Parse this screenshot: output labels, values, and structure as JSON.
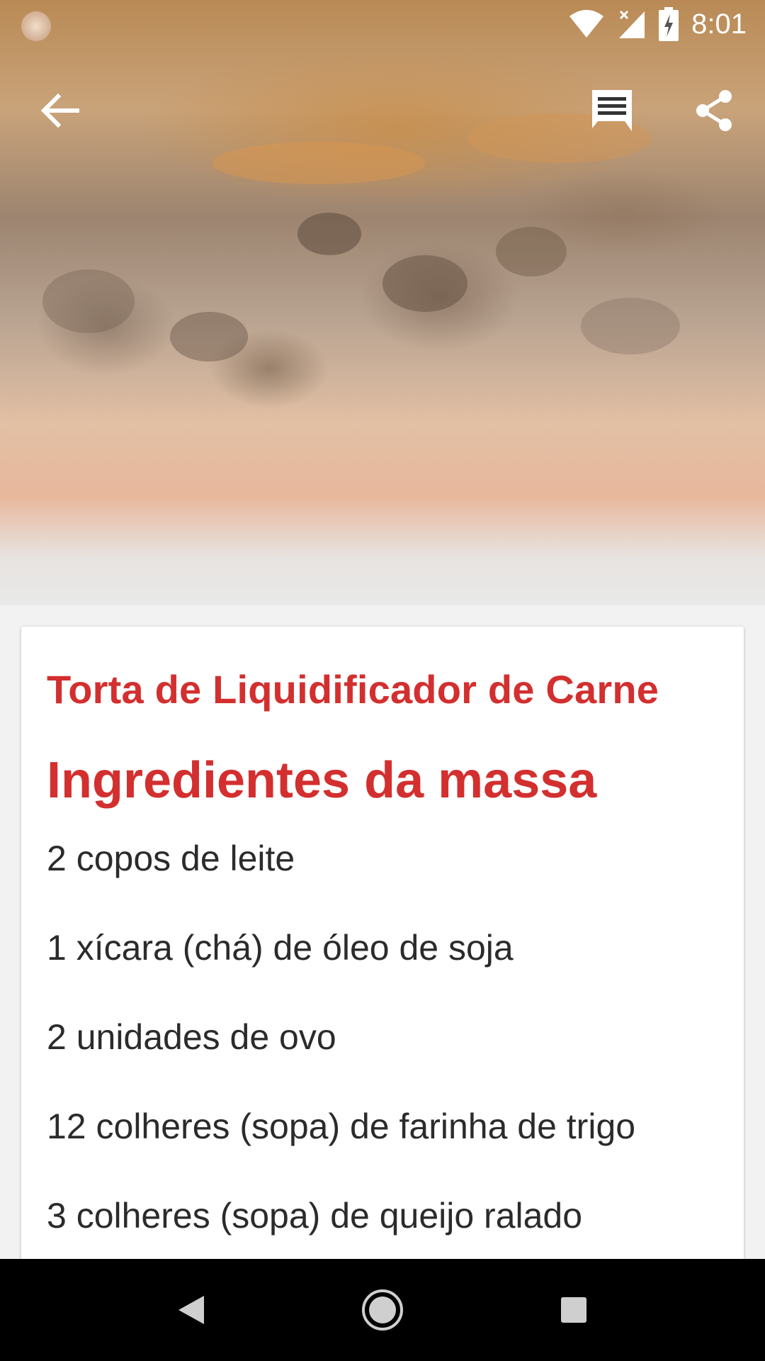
{
  "status_bar": {
    "time": "8:01"
  },
  "toolbar": {
    "back_icon": "arrow-back-icon",
    "comments_icon": "comment-icon",
    "share_icon": "share-icon"
  },
  "recipe": {
    "title": "Torta de Liquidificador de Carne",
    "section_title": "Ingredientes da massa",
    "ingredients": [
      "2 copos de leite",
      "1 xícara (chá) de óleo de soja",
      "2 unidades de ovo",
      "12 colheres (sopa) de farinha de trigo",
      "3 colheres (sopa) de queijo ralado"
    ]
  },
  "colors": {
    "accent": "#d32f2f",
    "text": "#2b2b2b",
    "nav_bar": "#000000"
  }
}
